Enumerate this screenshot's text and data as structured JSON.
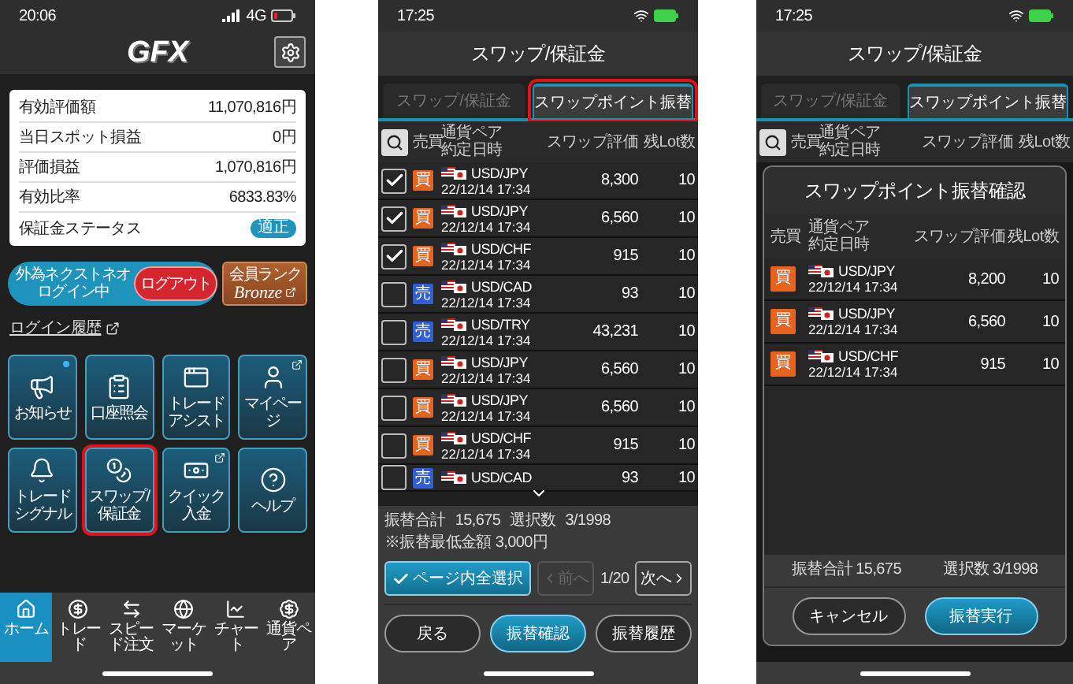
{
  "home_screen": {
    "status": {
      "time": "20:06",
      "network": "4G"
    },
    "logo": "GFX",
    "summary": [
      {
        "label": "有効評価額",
        "value": "11,070,816円",
        "kind": "value"
      },
      {
        "label": "当日スポット損益",
        "value": "0円",
        "kind": "value"
      },
      {
        "label": "評価損益",
        "value": "1,070,816円",
        "kind": "value"
      },
      {
        "label": "有効比率",
        "value": "6833.83%",
        "kind": "value"
      },
      {
        "label": "保証金ステータス",
        "value": "適正",
        "kind": "status"
      }
    ],
    "login": {
      "service": "外為ネクストネオ",
      "state": "ログイン中",
      "logout": "ログアウト"
    },
    "rank": {
      "label": "会員ランク",
      "name": "Bronze"
    },
    "history_link": "ログイン履歴",
    "tiles": [
      {
        "label": "お知らせ",
        "highlighted": false,
        "external": false,
        "unread": true
      },
      {
        "label": "口座照会",
        "highlighted": false,
        "external": false,
        "unread": false
      },
      {
        "label": "トレードアシスト",
        "highlighted": false,
        "external": false,
        "unread": false
      },
      {
        "label": "マイページ",
        "highlighted": false,
        "external": true,
        "unread": false
      },
      {
        "label": "トレードシグナル",
        "highlighted": false,
        "external": false,
        "unread": false
      },
      {
        "label": "スワップ/保証金",
        "highlighted": true,
        "external": false,
        "unread": false
      },
      {
        "label": "クイック入金",
        "highlighted": false,
        "external": true,
        "unread": false
      },
      {
        "label": "ヘルプ",
        "highlighted": false,
        "external": false,
        "unread": false
      }
    ],
    "nav": [
      {
        "label": "ホーム",
        "selected": true
      },
      {
        "label": "トレード",
        "selected": false
      },
      {
        "label": "スピード注文",
        "selected": false
      },
      {
        "label": "マーケット",
        "selected": false
      },
      {
        "label": "チャート",
        "selected": false
      },
      {
        "label": "通貨ペア",
        "selected": false
      }
    ]
  },
  "swap_screen": {
    "status": {
      "time": "17:25"
    },
    "title": "スワップ/保証金",
    "tabs": [
      {
        "label": "スワップ/保証金",
        "selected": false,
        "highlighted": false
      },
      {
        "label": "スワップポイント振替",
        "selected": true,
        "highlighted": true
      }
    ],
    "columns": {
      "side": "売買",
      "pair": "通貨ペア",
      "date": "約定日時",
      "swap": "スワップ評価",
      "lots": "残Lot数"
    },
    "rows": [
      {
        "checked": true,
        "side": "買",
        "kind": "buy",
        "pair": "USD/JPY",
        "date": "22/12/14 17:34",
        "swap": "8,300",
        "lots": "10"
      },
      {
        "checked": true,
        "side": "買",
        "kind": "buy",
        "pair": "USD/JPY",
        "date": "22/12/14 17:34",
        "swap": "6,560",
        "lots": "10"
      },
      {
        "checked": true,
        "side": "買",
        "kind": "buy",
        "pair": "USD/CHF",
        "date": "22/12/14 17:34",
        "swap": "915",
        "lots": "10"
      },
      {
        "checked": false,
        "side": "売",
        "kind": "sell",
        "pair": "USD/CAD",
        "date": "22/12/14 17:34",
        "swap": "93",
        "lots": "10"
      },
      {
        "checked": false,
        "side": "売",
        "kind": "sell",
        "pair": "USD/TRY",
        "date": "22/12/14 17:34",
        "swap": "43,231",
        "lots": "10"
      },
      {
        "checked": false,
        "side": "買",
        "kind": "buy",
        "pair": "USD/JPY",
        "date": "22/12/14 17:34",
        "swap": "6,560",
        "lots": "10"
      },
      {
        "checked": false,
        "side": "買",
        "kind": "buy",
        "pair": "USD/JPY",
        "date": "22/12/14 17:34",
        "swap": "6,560",
        "lots": "10"
      },
      {
        "checked": false,
        "side": "買",
        "kind": "buy",
        "pair": "USD/CHF",
        "date": "22/12/14 17:34",
        "swap": "915",
        "lots": "10"
      },
      {
        "checked": false,
        "side": "売",
        "kind": "sell",
        "pair": "USD/CAD",
        "swap": "93",
        "lots": "10"
      }
    ],
    "summary": {
      "total_label": "振替合計",
      "total": "15,675",
      "count_label": "選択数",
      "count": "3/1998",
      "note": "※振替最低金額 3,000円"
    },
    "select_all": "ページ内全選択",
    "prev": {
      "label": "前へ",
      "disabled": true
    },
    "page": "1/20",
    "next": {
      "label": "次へ",
      "disabled": false
    },
    "buttons": [
      {
        "label": "戻る",
        "kind": "secondary"
      },
      {
        "label": "振替確認",
        "kind": "primary"
      },
      {
        "label": "振替履歴",
        "kind": "secondary"
      }
    ]
  },
  "confirm_screen": {
    "status": {
      "time": "17:25"
    },
    "title": "スワップ/保証金",
    "tabs": [
      {
        "label": "スワップ/保証金",
        "selected": false,
        "highlighted": false
      },
      {
        "label": "スワップポイント振替",
        "selected": true,
        "highlighted": false
      }
    ],
    "columns": {
      "side": "売買",
      "pair": "通貨ペア",
      "date": "約定日時",
      "swap": "スワップ評価",
      "lots": "残Lot数"
    },
    "dialog": {
      "title": "スワップポイント振替確認",
      "columns": {
        "side": "売買",
        "pair": "通貨ペア",
        "date": "約定日時",
        "swap": "スワップ評価",
        "lots": "残Lot数"
      },
      "rows": [
        {
          "side": "買",
          "kind": "buy",
          "pair": "USD/JPY",
          "date": "22/12/14 17:34",
          "swap": "8,200",
          "lots": "10"
        },
        {
          "side": "買",
          "kind": "buy",
          "pair": "USD/JPY",
          "date": "22/12/14 17:34",
          "swap": "6,560",
          "lots": "10"
        },
        {
          "side": "買",
          "kind": "buy",
          "pair": "USD/CHF",
          "date": "22/12/14 17:34",
          "swap": "915",
          "lots": "10"
        }
      ],
      "total_label": "振替合計",
      "total": "15,675",
      "count_label": "選択数",
      "count": "3/1998",
      "buttons": [
        {
          "label": "キャンセル",
          "kind": "secondary"
        },
        {
          "label": "振替実行",
          "kind": "primary"
        }
      ]
    }
  }
}
